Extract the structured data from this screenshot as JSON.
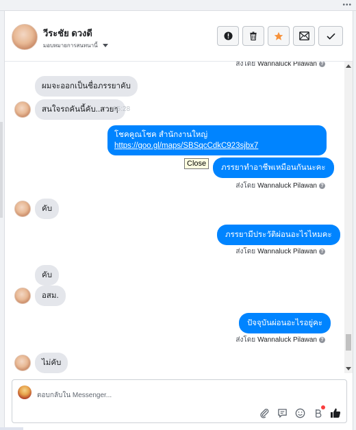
{
  "window": {
    "menu_dots": "•••"
  },
  "header": {
    "contact_name": "วีระชัย ดวงดี",
    "assign_label": "มอบหมายการสนทนานี้",
    "actions": [
      {
        "name": "report-icon"
      },
      {
        "name": "trash-icon"
      },
      {
        "name": "star-icon"
      },
      {
        "name": "mark-unread-icon"
      },
      {
        "name": "checkmark-icon"
      }
    ]
  },
  "colors": {
    "accent": "#0084ff",
    "incoming_bg": "#e4e6eb",
    "star": "#f7923b"
  },
  "messages": {
    "sent_by_prefix": "ส่งโดย",
    "sender_name": "Wannaluck Pilawan",
    "in_1": "ผมจะออกเป็นชื่อภรรยาคับ",
    "in_2": "สนใจรถคันนี้คับ..สวยๆ",
    "in_2_time": "15:28",
    "out_1_line1": "โชคคูณโชค สำนักงานใหญ่",
    "out_1_link": "https://goo.gl/maps/SBSqcCdkC923sjbx7",
    "tooltip_close": "Close",
    "out_2": "ภรรยาทำอาชีพเหมือนกันนะคะ",
    "in_3": "คับ",
    "out_3": "ภรรยามีประวัติผ่อนอะไรไหมคะ",
    "in_4": "คับ",
    "in_5": "อสม.",
    "out_4": "ปัจจุบันผ่อนอะไรอยู่คะ",
    "in_6": "ไม่คับ"
  },
  "composer": {
    "placeholder": "ตอบกลับใน Messenger...",
    "tools": [
      "attachment-icon",
      "saved-reply-icon",
      "emoji-icon",
      "appointment-icon",
      "like-icon"
    ]
  }
}
